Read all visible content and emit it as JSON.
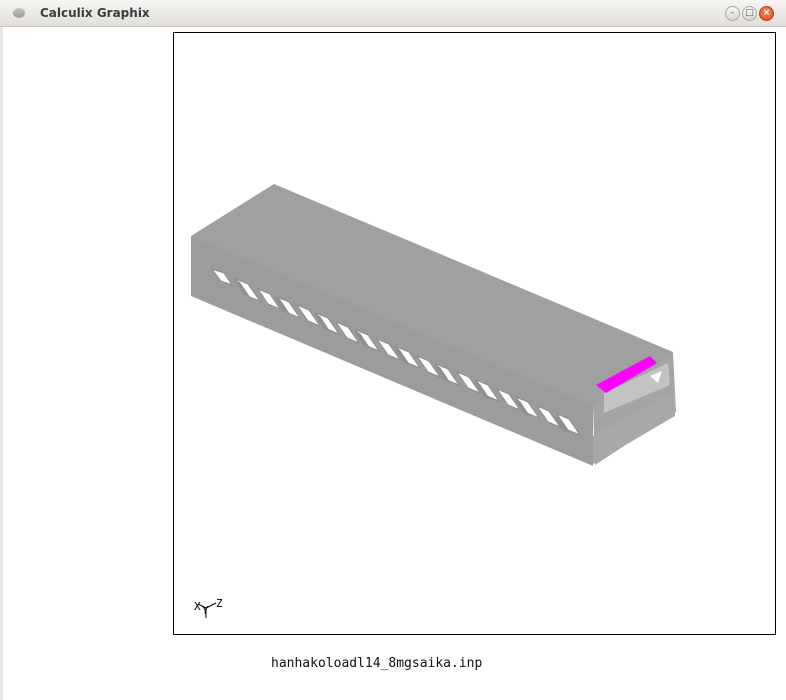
{
  "window": {
    "title": "Calculix Graphix",
    "buttons": {
      "minimize": "–",
      "maximize": "□",
      "close": "×"
    }
  },
  "viewport": {
    "model_color": "#a0a0a0",
    "highlight_color": "#ff00ff",
    "axis_triad": {
      "x_label": "X",
      "y_label": "Y",
      "z_label": "Z"
    }
  },
  "status": {
    "filename": "hanhakoloadl14_8mgsaika.inp"
  }
}
